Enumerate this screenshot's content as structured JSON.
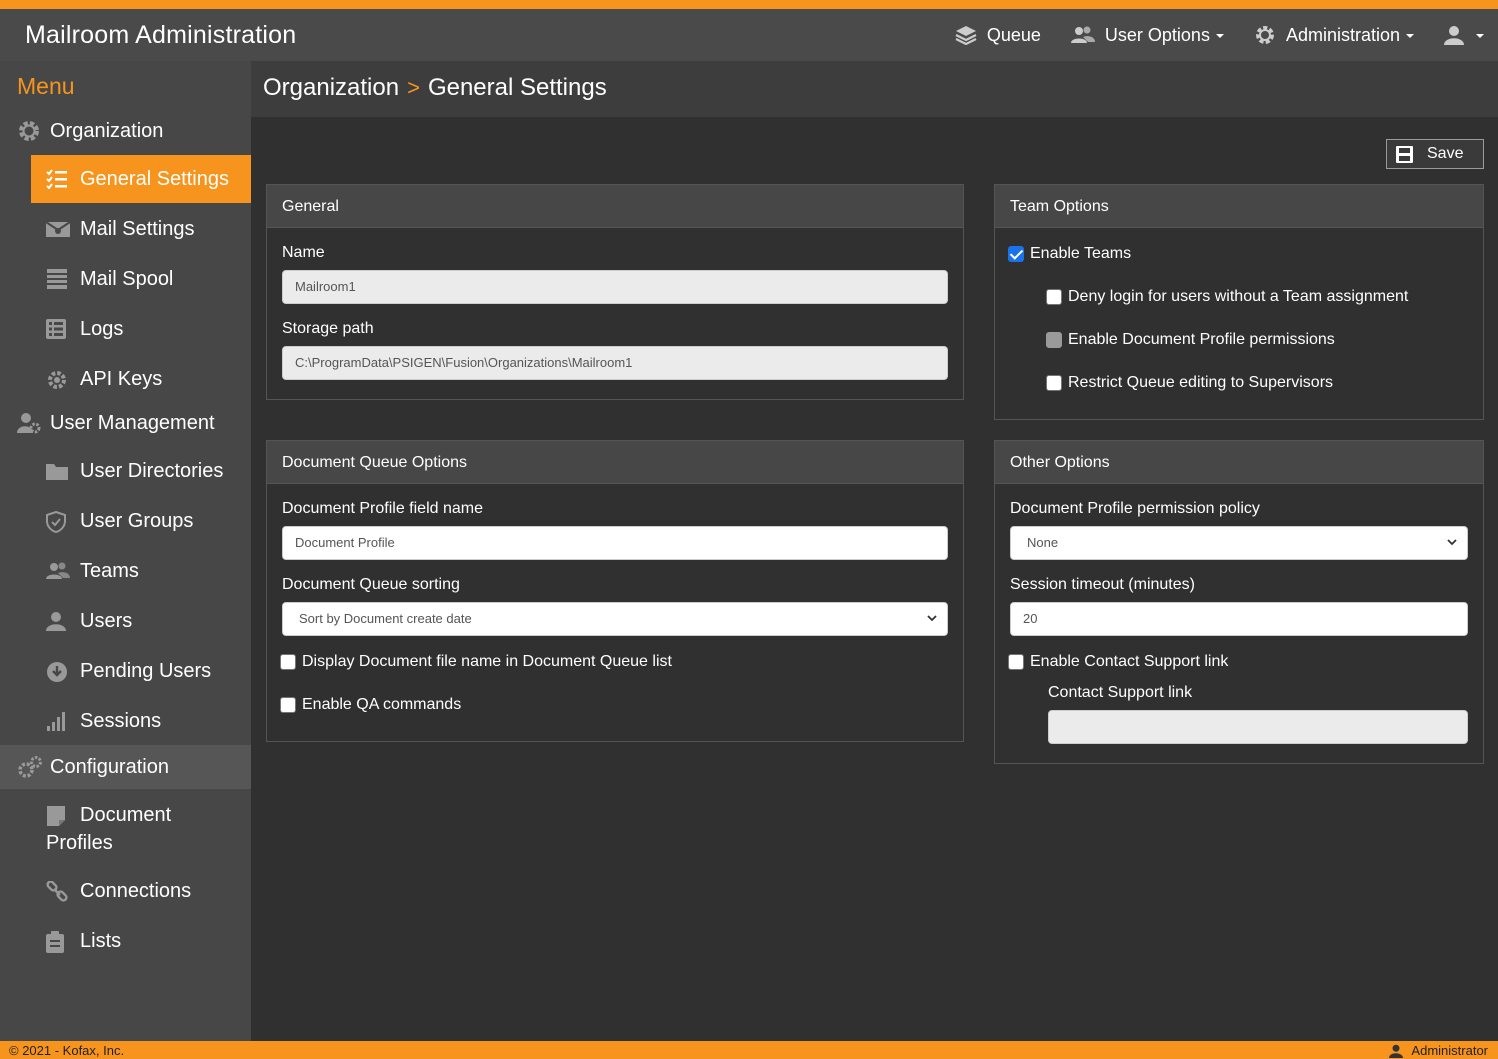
{
  "app": {
    "title": "Mailroom Administration"
  },
  "nav": {
    "queue": "Queue",
    "user_options": "User Options",
    "administration": "Administration"
  },
  "sidebar": {
    "menu_title": "Menu",
    "sections": {
      "organization": "Organization",
      "user_management": "User Management",
      "configuration": "Configuration"
    },
    "items": {
      "general_settings": "General Settings",
      "mail_settings": "Mail Settings",
      "mail_spool": "Mail Spool",
      "logs": "Logs",
      "api_keys": "API Keys",
      "user_directories": "User Directories",
      "user_groups": "User Groups",
      "teams": "Teams",
      "users": "Users",
      "pending_users": "Pending Users",
      "sessions": "Sessions",
      "document_profiles": "Document Profiles",
      "connections": "Connections",
      "lists": "Lists"
    }
  },
  "breadcrumb": {
    "parent": "Organization",
    "current": "General Settings",
    "separator": ">"
  },
  "toolbar": {
    "save_label": "Save"
  },
  "general": {
    "title": "General",
    "name_label": "Name",
    "name_value": "Mailroom1",
    "storage_label": "Storage path",
    "storage_value": "C:\\ProgramData\\PSIGEN\\Fusion\\Organizations\\Mailroom1"
  },
  "team_options": {
    "title": "Team Options",
    "enable_teams": "Enable Teams",
    "deny_login": "Deny login for users without a Team assignment",
    "enable_doc_profile_perm": "Enable Document Profile permissions",
    "restrict_queue": "Restrict Queue editing to Supervisors"
  },
  "queue_options": {
    "title": "Document Queue Options",
    "field_name_label": "Document Profile field name",
    "field_name_value": "Document Profile",
    "sorting_label": "Document Queue sorting",
    "sorting_value": "Sort by Document create date",
    "display_file_name": "Display Document file name in Document Queue list",
    "enable_qa": "Enable QA commands"
  },
  "other_options": {
    "title": "Other Options",
    "policy_label": "Document Profile permission policy",
    "policy_value": "None",
    "timeout_label": "Session timeout (minutes)",
    "timeout_value": "20",
    "enable_support": "Enable Contact Support link",
    "support_link_label": "Contact Support link",
    "support_link_value": ""
  },
  "footer": {
    "copyright": "© 2021 - Kofax, Inc.",
    "user": "Administrator"
  },
  "colors": {
    "accent": "#f7941d",
    "navbar": "#4a4a4a",
    "sidebar": "#474747",
    "background": "#303030",
    "checkbox_checked": "#1a73e8"
  }
}
